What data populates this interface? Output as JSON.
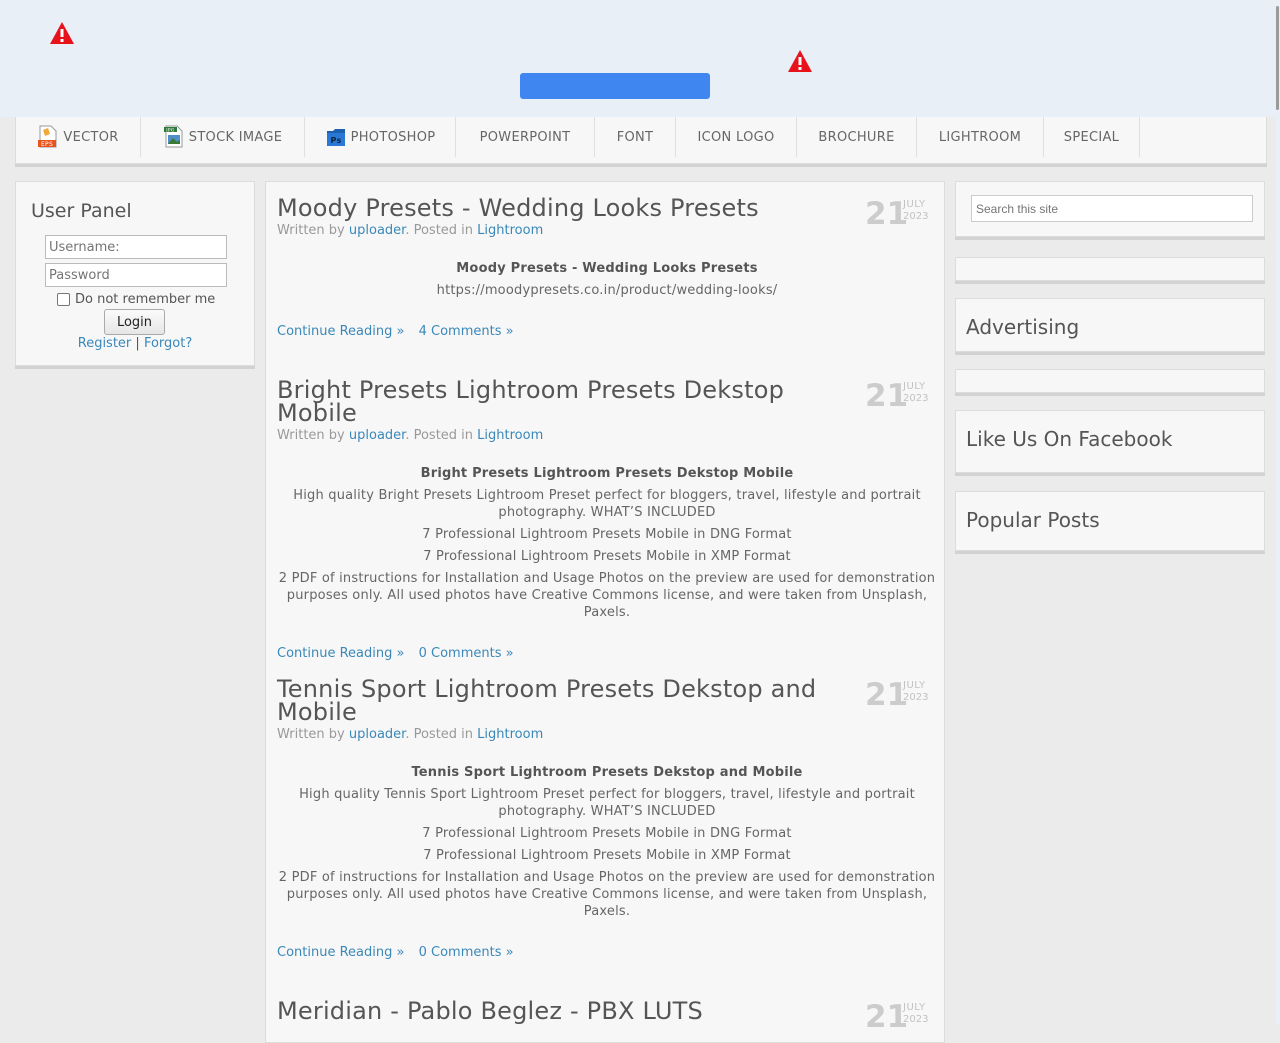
{
  "nav": {
    "items": [
      {
        "label": "VECTOR",
        "icon": "eps-file-icon"
      },
      {
        "label": "STOCK IMAGE",
        "icon": "jpg-file-icon"
      },
      {
        "label": "PHOTOSHOP",
        "icon": "photoshop-icon"
      },
      {
        "label": "POWERPOINT"
      },
      {
        "label": "FONT"
      },
      {
        "label": "ICON LOGO"
      },
      {
        "label": "BROCHURE"
      },
      {
        "label": "LIGHTROOM"
      },
      {
        "label": "SPECIAL"
      }
    ],
    "eps_badge": "EPS",
    "jpg_badge": "JPG",
    "ps_badge": "Ps"
  },
  "user_panel": {
    "title": "User Panel",
    "username_placeholder": "Username:",
    "password_placeholder": "Password",
    "remember_label": "Do not remember me",
    "login_label": "Login",
    "register_label": "Register",
    "separator": "|",
    "forgot_label": "Forgot?"
  },
  "posts": [
    {
      "title": "Moody Presets - Wedding Looks Presets",
      "meta_prefix": "Written by",
      "author": "uploader",
      "meta_mid": ". Posted in",
      "category": "Lightroom",
      "day": "21",
      "month": "JULY",
      "year": "2023",
      "body_title": "Moody Presets - Wedding Looks Presets",
      "body_lines": [
        "https://moodypresets.co.in/product/wedding-looks/"
      ],
      "continue_label": "Continue Reading »",
      "comments_label": "4 Comments »"
    },
    {
      "title": "Bright Presets Lightroom Presets Dekstop Mobile",
      "meta_prefix": "Written by",
      "author": "uploader",
      "meta_mid": ". Posted in",
      "category": "Lightroom",
      "day": "21",
      "month": "JULY",
      "year": "2023",
      "body_title": "Bright Presets Lightroom Presets Dekstop Mobile",
      "body_lines": [
        "High quality Bright Presets Lightroom Preset perfect for bloggers, travel, lifestyle and portrait photography. WHAT’S INCLUDED",
        "7 Professional Lightroom Presets Mobile in DNG Format",
        "7 Professional Lightroom Presets Mobile in XMP Format",
        "2 PDF of instructions for Installation and Usage Photos on the preview are used for demonstration purposes only. All used photos have Creative Commons license, and were taken from Unsplash, Paxels."
      ],
      "continue_label": "Continue Reading »",
      "comments_label": "0 Comments »"
    },
    {
      "title": "Tennis Sport Lightroom Presets Dekstop and Mobile",
      "meta_prefix": "Written by",
      "author": "uploader",
      "meta_mid": ". Posted in",
      "category": "Lightroom",
      "day": "21",
      "month": "JULY",
      "year": "2023",
      "body_title": "Tennis Sport Lightroom Presets Dekstop and Mobile",
      "body_lines": [
        "High quality Tennis Sport Lightroom Preset perfect for bloggers, travel, lifestyle and portrait photography. WHAT’S INCLUDED",
        "7 Professional Lightroom Presets Mobile in DNG Format",
        "7 Professional Lightroom Presets Mobile in XMP Format",
        "2 PDF of instructions for Installation and Usage Photos on the preview are used for demonstration purposes only. All used photos have Creative Commons license, and were taken from Unsplash, Paxels."
      ],
      "continue_label": "Continue Reading »",
      "comments_label": "0 Comments »"
    },
    {
      "title": "Meridian - Pablo Beglez - PBX LUTS",
      "day": "21",
      "month": "JULY",
      "year": "2023"
    }
  ],
  "sidebar": {
    "search_placeholder": "Search this site",
    "advertising_title": "Advertising",
    "facebook_title": "Like Us On Facebook",
    "popular_title": "Popular Posts"
  },
  "colors": {
    "banner_bg": "#e9eff7",
    "banner_button": "#3f86f0",
    "link": "#3a88b8",
    "warning": "#e8121b"
  }
}
